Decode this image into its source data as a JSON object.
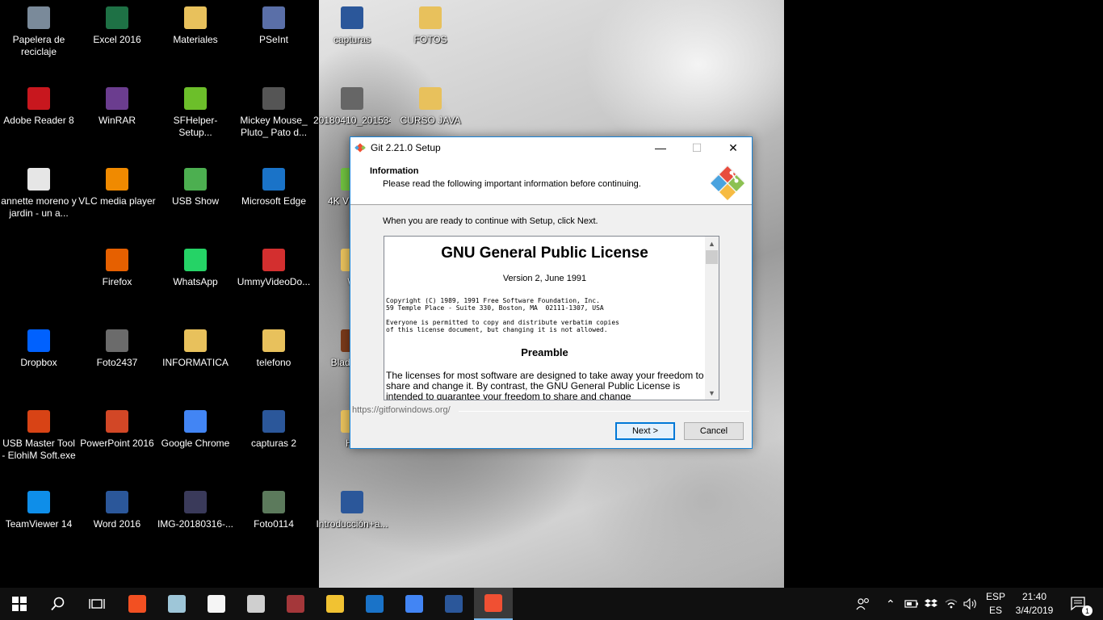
{
  "desktop": {
    "icons": [
      {
        "label": "Papelera de reciclaje",
        "icon": "recycle-bin-icon",
        "color": "#7a8a9a"
      },
      {
        "label": "Excel 2016",
        "icon": "excel-icon",
        "color": "#1e7145"
      },
      {
        "label": "Materiales",
        "icon": "folder-icon",
        "color": "#e8c15c"
      },
      {
        "label": "PSeInt",
        "icon": "pseint-icon",
        "color": "#5a6fa8"
      },
      {
        "label": "capturas",
        "icon": "word-doc-icon",
        "color": "#2b579a"
      },
      {
        "label": "FOTOS",
        "icon": "folder-icon",
        "color": "#e8c15c"
      },
      {
        "label": "Adobe Reader 8",
        "icon": "adobe-reader-icon",
        "color": "#c8171e"
      },
      {
        "label": "WinRAR",
        "icon": "winrar-icon",
        "color": "#6b3d8f"
      },
      {
        "label": "SFHelper-Setup...",
        "icon": "download-arrow-icon",
        "color": "#6cbf2a"
      },
      {
        "label": "Mickey Mouse_ Pluto_ Pato d...",
        "icon": "video-thumbnail-icon",
        "color": "#555555"
      },
      {
        "label": "20180410_201534",
        "icon": "photo-thumbnail-icon",
        "color": "#666666"
      },
      {
        "label": "CURSO JAVA",
        "icon": "folder-icon",
        "color": "#e8c15c"
      },
      {
        "label": "annette moreno y jardin - un a...",
        "icon": "media-file-icon",
        "color": "#e6e6e6"
      },
      {
        "label": "VLC media player",
        "icon": "vlc-icon",
        "color": "#f08a00"
      },
      {
        "label": "USB Show",
        "icon": "usb-show-icon",
        "color": "#4caf50"
      },
      {
        "label": "Microsoft Edge",
        "icon": "edge-icon",
        "color": "#1a73c8"
      },
      {
        "label": "4K V Down",
        "icon": "4k-downloader-icon",
        "color": "#6fbf3f"
      },
      {
        "label": "Firefox",
        "icon": "firefox-icon",
        "color": "#e66000"
      },
      {
        "label": "WhatsApp",
        "icon": "whatsapp-icon",
        "color": "#25d366"
      },
      {
        "label": "UmmyVideoDo...",
        "icon": "ummy-video-icon",
        "color": "#d32f2f"
      },
      {
        "label": "W",
        "icon": "generic-file-icon",
        "color": "#e8c15c"
      },
      {
        "label": "Dropbox",
        "icon": "dropbox-icon",
        "color": "#0061fe"
      },
      {
        "label": "Foto2437",
        "icon": "photo-thumbnail-icon",
        "color": "#6b6b6b"
      },
      {
        "label": "INFORMATICA",
        "icon": "folder-icon",
        "color": "#e8c15c"
      },
      {
        "label": "telefono",
        "icon": "folder-icon",
        "color": "#e8c15c"
      },
      {
        "label": "Blade_Re",
        "icon": "game-icon",
        "color": "#7a3a1a"
      },
      {
        "label": "USB Master Tool - ElohiM Soft.exe",
        "icon": "usb-tool-icon",
        "color": "#d84315"
      },
      {
        "label": "PowerPoint 2016",
        "icon": "powerpoint-icon",
        "color": "#d24726"
      },
      {
        "label": "Google Chrome",
        "icon": "chrome-icon",
        "color": "#4285f4"
      },
      {
        "label": "capturas 2",
        "icon": "word-doc-icon",
        "color": "#2b579a"
      },
      {
        "label": "HT",
        "icon": "generic-file-icon",
        "color": "#e8c15c"
      },
      {
        "label": "TeamViewer 14",
        "icon": "teamviewer-icon",
        "color": "#0e8ee9"
      },
      {
        "label": "Word 2016",
        "icon": "word-icon",
        "color": "#2b579a"
      },
      {
        "label": "IMG-20180316-...",
        "icon": "photo-thumbnail-icon",
        "color": "#3a3a5a"
      },
      {
        "label": "Foto0114",
        "icon": "photo-thumbnail-icon",
        "color": "#5c7a5c"
      },
      {
        "label": "Introducción+a...",
        "icon": "pdf-icon",
        "color": "#2b579a"
      }
    ]
  },
  "dialog": {
    "title": "Git 2.21.0 Setup",
    "controls": {
      "minimize": "—",
      "maximize": "☐",
      "close": "✕"
    },
    "header_title": "Information",
    "header_subtitle": "Please read the following important information before continuing.",
    "intro": "When you are ready to continue with Setup, click Next.",
    "license": {
      "heading": "GNU General Public License",
      "version": "Version 2, June 1991",
      "copyright_1": "Copyright (C) 1989, 1991 Free Software Foundation, Inc.",
      "copyright_2": "59 Temple Place - Suite 330, Boston, MA  02111-1307, USA",
      "permission_1": "Everyone is permitted to copy and distribute verbatim copies",
      "permission_2": "of this license document, but changing it is not allowed.",
      "preamble": "Preamble",
      "paragraph": "  The licenses for most software are designed to take away your freedom to share and change it. By contrast, the GNU General Public License is intended to guarantee your freedom to share and change"
    },
    "url": "https://gitforwindows.org/",
    "next_label": "Next >",
    "cancel_label": "Cancel"
  },
  "taskbar": {
    "apps": [
      {
        "name": "start-button",
        "icon": "windows-logo-icon"
      },
      {
        "name": "search-button",
        "icon": "search-icon"
      },
      {
        "name": "task-view-button",
        "icon": "task-view-icon"
      },
      {
        "name": "store-app",
        "icon": "store-icon",
        "color": "#f25022"
      },
      {
        "name": "app-tile",
        "icon": "tile-icon",
        "color": "#9ec6d8"
      },
      {
        "name": "notepad-app",
        "icon": "document-icon",
        "color": "#f5f5f5"
      },
      {
        "name": "game-app",
        "icon": "game-character-icon",
        "color": "#cfcfcf"
      },
      {
        "name": "access-app",
        "icon": "access-icon",
        "color": "#a4373a"
      },
      {
        "name": "file-explorer-app",
        "icon": "folder-icon",
        "color": "#f1c232"
      },
      {
        "name": "edge-app",
        "icon": "edge-icon",
        "color": "#1a73c8"
      },
      {
        "name": "chrome-app",
        "icon": "chrome-icon",
        "color": "#4285f4"
      },
      {
        "name": "word-app",
        "icon": "word-icon",
        "color": "#2b579a"
      },
      {
        "name": "git-setup-app",
        "icon": "git-logo-icon",
        "color": "#f05033"
      }
    ],
    "language_top": "ESP",
    "language_bottom": "ES",
    "time": "21:40",
    "date": "3/4/2019",
    "notification_count": "1"
  }
}
